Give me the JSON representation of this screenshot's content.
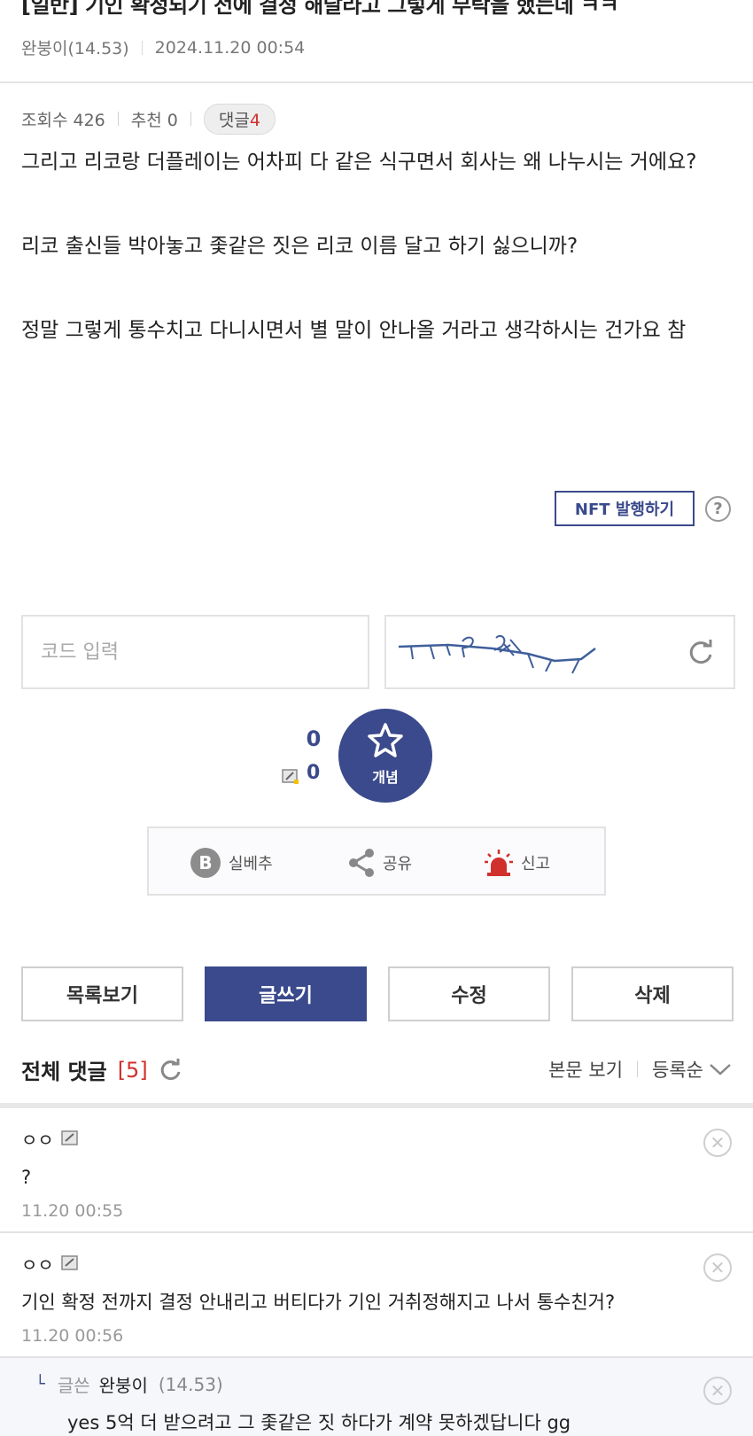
{
  "post": {
    "title": "[일반] 기인 확정되기 전에 결정 해달라고 그렇게 부탁을 했는데 ㅋㅋ",
    "author": "완붕이(14.53)",
    "date": "2024.11.20 00:54",
    "views_label": "조회수 426",
    "recommend_label": "추천 0",
    "comment_pill_label": "댓글",
    "comment_pill_count": "4",
    "body": [
      "그리고 리코랑 더플레이는 어차피 다 같은 식구면서 회사는 왜 나누시는 거에요?",
      "리코 출신들 박아놓고 좇같은 짓은 리코 이름 달고 하기 싫으니까?",
      "정말 그렇게 통수치고 다니시면서 별 말이 안나올 거라고 생각하시는 건가요 참"
    ],
    "nft_button": "NFT 발행하기",
    "help_icon": "?"
  },
  "captcha": {
    "placeholder": "코드 입력"
  },
  "recommend": {
    "count": "0",
    "sub_count": "0",
    "button_label": "개념"
  },
  "actions": {
    "silbechu": "실베추",
    "share": "공유",
    "report": "신고"
  },
  "buttons": {
    "list": "목록보기",
    "write": "글쓰기",
    "edit": "수정",
    "delete": "삭제"
  },
  "comments_section": {
    "title": "전체 댓글",
    "count": "[5]",
    "view_body": "본문 보기",
    "sort": "등록순"
  },
  "comments": [
    {
      "name": "ㅇㅇ",
      "text": "?",
      "date": "11.20 00:55"
    },
    {
      "name": "ㅇㅇ",
      "text": "기인 확정 전까지 결정 안내리고 버티다가 기인 거취정해지고 나서 통수친거?",
      "date": "11.20 00:56"
    }
  ],
  "reply": {
    "label": "글쓴",
    "name": "완붕이",
    "score": "(14.53)",
    "text": "yes 5억 더 받으려고 그 좇같은 짓 하다가 계약 못하겠답니다 gg"
  },
  "colors": {
    "brand": "#3a4a8c",
    "accent_red": "#d0312d"
  }
}
